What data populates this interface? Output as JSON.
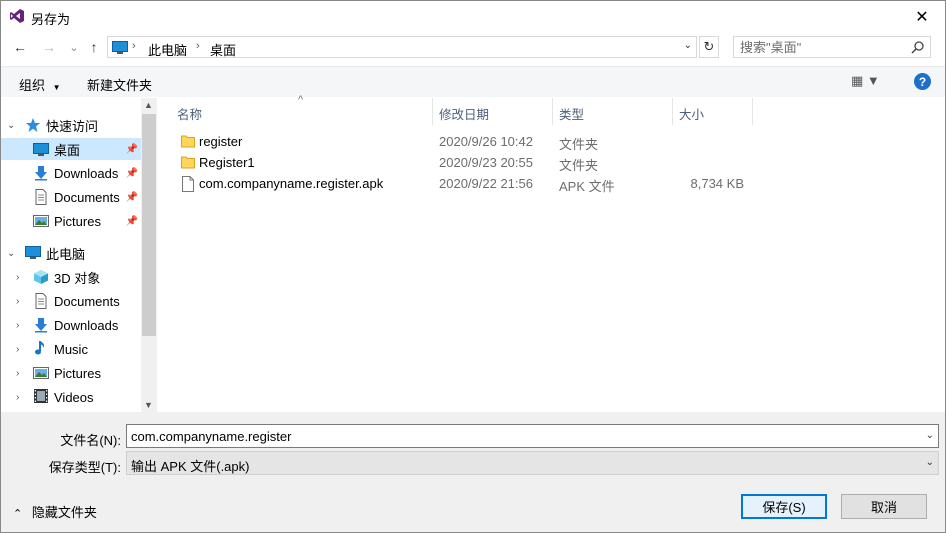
{
  "window": {
    "title": "另存为",
    "close_glyph": "✕"
  },
  "nav": {
    "back_glyph": "←",
    "forward_glyph": "→",
    "recent_glyph": "⌄",
    "up_glyph": "↑",
    "breadcrumb": [
      "此电脑",
      "桌面"
    ],
    "breadcrumb_sep": "›",
    "refresh_glyph": "↻",
    "search_placeholder": "搜索\"桌面\""
  },
  "toolbar": {
    "organize_label": "组织",
    "organize_arrow": "▼",
    "new_folder_label": "新建文件夹",
    "view_glyph": "▦ ▼",
    "help_glyph": "?"
  },
  "sidebar": {
    "quick_access": {
      "label": "快速访问",
      "arrow": "⌄"
    },
    "quick_items": [
      {
        "label": "桌面",
        "icon": "desktop-icon",
        "pin": "📌"
      },
      {
        "label": "Downloads",
        "icon": "download-icon",
        "pin": "📌"
      },
      {
        "label": "Documents",
        "icon": "document-icon",
        "pin": "📌"
      },
      {
        "label": "Pictures",
        "icon": "pictures-icon",
        "pin": "📌"
      }
    ],
    "this_pc": {
      "label": "此电脑",
      "arrow": "⌄"
    },
    "pc_items": [
      {
        "label": "3D 对象",
        "icon": "3d-objects-icon",
        "arrow": "›"
      },
      {
        "label": "Documents",
        "icon": "document-icon",
        "arrow": "›"
      },
      {
        "label": "Downloads",
        "icon": "download-icon",
        "arrow": "›"
      },
      {
        "label": "Music",
        "icon": "music-icon",
        "arrow": "›"
      },
      {
        "label": "Pictures",
        "icon": "pictures-icon",
        "arrow": "›"
      },
      {
        "label": "Videos",
        "icon": "videos-icon",
        "arrow": "›"
      }
    ],
    "scroll_up": "▲",
    "scroll_down": "▼"
  },
  "filelist": {
    "sort_indicator": "^",
    "columns": [
      "名称",
      "修改日期",
      "类型",
      "大小"
    ],
    "rows": [
      {
        "name": "register",
        "date": "2020/9/26 10:42",
        "type": "文件夹",
        "size": "",
        "icon": "folder-icon"
      },
      {
        "name": "Register1",
        "date": "2020/9/23 20:55",
        "type": "文件夹",
        "size": "",
        "icon": "folder-icon"
      },
      {
        "name": "com.companyname.register.apk",
        "date": "2020/9/22 21:56",
        "type": "APK 文件",
        "size": "8,734 KB",
        "icon": "file-icon"
      }
    ]
  },
  "form": {
    "filename_label": "文件名(N):",
    "filename_value": "com.companyname.register",
    "filetype_label": "保存类型(T):",
    "filetype_value": "输出 APK 文件(.apk)",
    "dropdown_glyph": "⌄",
    "hide_folders_label": "隐藏文件夹",
    "hide_folders_arrow": "⌃",
    "save_label": "保存(S)",
    "cancel_label": "取消"
  },
  "colors": {
    "selection": "#cce8ff",
    "accent": "#0078d7",
    "folder": "#ffd55c"
  }
}
